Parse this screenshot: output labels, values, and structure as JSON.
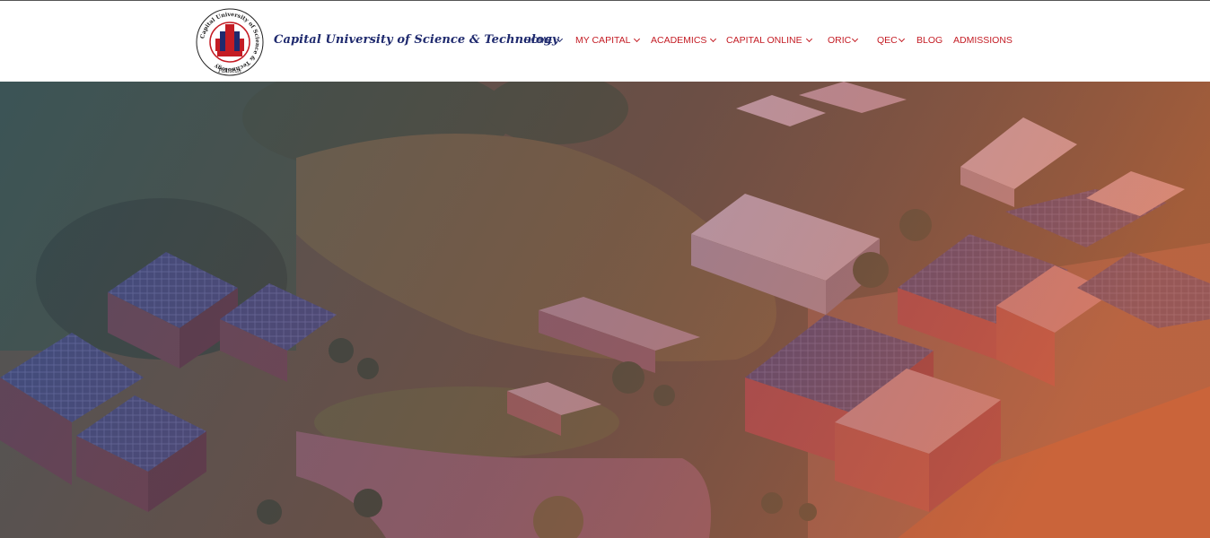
{
  "header": {
    "logo_ring_text": "Capital University of Science & Technology",
    "logo_bottom_text": "Pakistan",
    "brand_name": "Capital University of Science & Technology"
  },
  "nav": {
    "items": [
      {
        "label": "HOME",
        "has_dropdown": true,
        "color": "#1f2a6e"
      },
      {
        "label": "MY CAPITAL",
        "has_dropdown": true,
        "color": "#c41c24"
      },
      {
        "label": "ACADEMICS",
        "has_dropdown": true,
        "color": "#c41c24"
      },
      {
        "label": "CAPITAL ONLINE",
        "has_dropdown": true,
        "color": "#c41c24"
      },
      {
        "label": "ORIC",
        "has_dropdown": true,
        "color": "#c41c24"
      },
      {
        "label": "QEC",
        "has_dropdown": true,
        "color": "#c41c24"
      },
      {
        "label": "BLOG",
        "has_dropdown": false,
        "color": "#c41c24"
      },
      {
        "label": "ADMISSIONS",
        "has_dropdown": false,
        "color": "#c41c24"
      }
    ]
  },
  "colors": {
    "brand_navy": "#1f2a6e",
    "brand_red": "#c41c24",
    "hero_overlay_start": "#3a4a8a",
    "hero_overlay_end": "#e0603a"
  }
}
